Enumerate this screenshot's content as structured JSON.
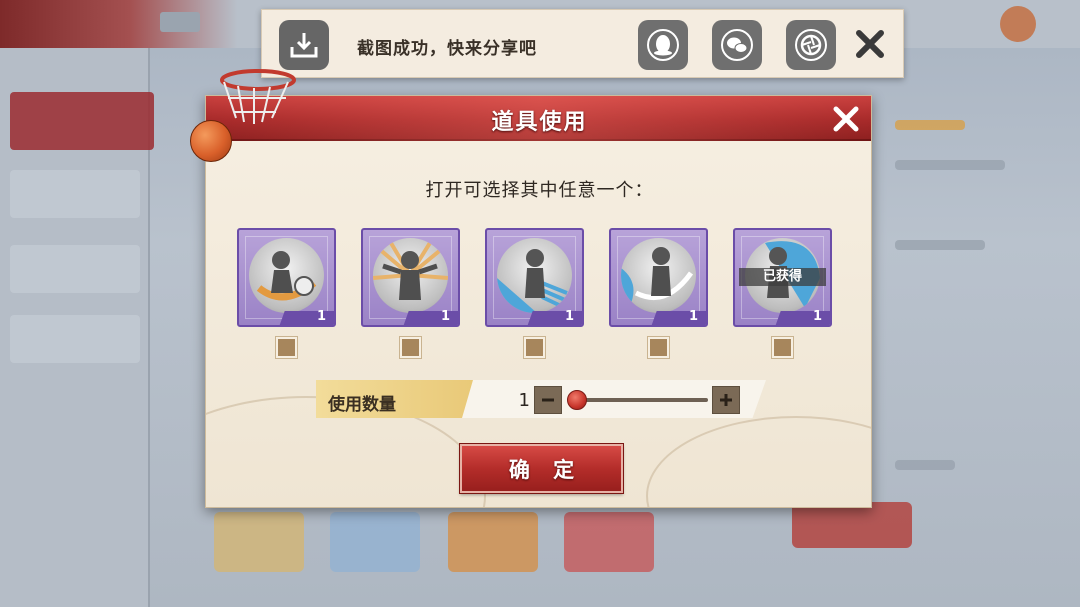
{
  "share": {
    "message": "截图成功，快来分享吧",
    "buttons": [
      {
        "icon": "download-icon"
      },
      {
        "icon": "qq-penguin-icon"
      },
      {
        "icon": "wechat-icon"
      },
      {
        "icon": "camera-shutter-icon"
      },
      {
        "icon": "close-icon"
      }
    ]
  },
  "dialog": {
    "title": "道具使用",
    "instruction": "打开可选择其中任意一个：",
    "items": [
      {
        "count": "1",
        "owned": false
      },
      {
        "count": "1",
        "owned": false
      },
      {
        "count": "1",
        "owned": false
      },
      {
        "count": "1",
        "owned": false
      },
      {
        "count": "1",
        "owned": true,
        "owned_label": "已获得"
      }
    ],
    "quantity": {
      "label": "使用数量",
      "value": "1",
      "minus_icon": "minus-icon",
      "plus_icon": "plus-icon"
    },
    "confirm_label": "确 定"
  },
  "colors": {
    "header_red": "#a82a2a",
    "item_purple": "#9a82c6",
    "checkbox_brown": "#a7865c",
    "confirm_red": "#b42d2a"
  }
}
